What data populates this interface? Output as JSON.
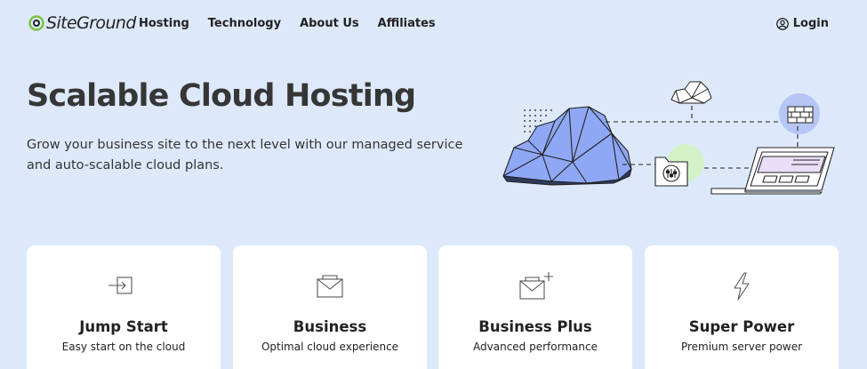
{
  "brand": {
    "name": "SiteGround"
  },
  "nav": {
    "links": [
      "Hosting",
      "Technology",
      "About Us",
      "Affiliates"
    ],
    "login_label": "Login"
  },
  "hero": {
    "title": "Scalable Cloud Hosting",
    "subtitle": "Grow your business site to the next level with our managed service and auto-scalable cloud plans."
  },
  "plans": [
    {
      "title": "Jump Start",
      "desc": "Easy start on the cloud",
      "icon": "enter-arrow-icon"
    },
    {
      "title": "Business",
      "desc": "Optimal cloud experience",
      "icon": "envelope-icon"
    },
    {
      "title": "Business Plus",
      "desc": "Advanced performance",
      "icon": "envelope-plus-icon"
    },
    {
      "title": "Super Power",
      "desc": "Premium server power",
      "icon": "lightning-icon"
    }
  ],
  "colors": {
    "background": "#dde9fb",
    "card": "#ffffff",
    "cloud_fill": "#8fa8f5",
    "brand_green": "#7cc243",
    "text": "#333333"
  }
}
